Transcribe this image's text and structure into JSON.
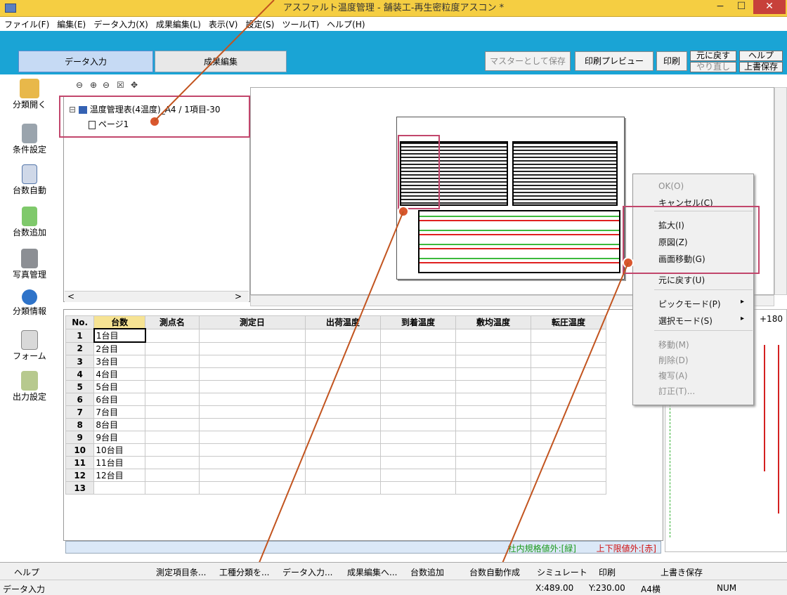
{
  "window": {
    "title": "アスファルト温度管理 - 舗装工-再生密粒度アスコン *",
    "minimize": "−",
    "maximize": "☐",
    "close": "✕"
  },
  "menu": [
    "ファイル(F)",
    "編集(E)",
    "データ入力(X)",
    "成果編集(L)",
    "表示(V)",
    "設定(S)",
    "ツール(T)",
    "ヘルプ(H)"
  ],
  "toolbar": {
    "tab_data": "データ入力",
    "tab_result": "成果編集",
    "save_master": "マスターとして保存",
    "print_preview": "印刷プレビュー",
    "print": "印刷",
    "undo": "元に戻す",
    "redo": "やり直し",
    "help": "ヘルプ",
    "overwrite": "上書保存"
  },
  "sidebar": [
    "分類開く",
    "条件設定",
    "台数自動",
    "台数追加",
    "写真管理",
    "分類情報",
    "フォーム",
    "出力設定"
  ],
  "tree": {
    "root": "温度管理表(4温度)_A4 / 1項目-30",
    "page": "ページ1"
  },
  "grid": {
    "columns": [
      "No.",
      "台数",
      "測点名",
      "測定日",
      "出荷温度",
      "到着温度",
      "敷均温度",
      "転圧温度"
    ],
    "rows": [
      [
        "1",
        "1台目"
      ],
      [
        "2",
        "2台目"
      ],
      [
        "3",
        "3台目"
      ],
      [
        "4",
        "4台目"
      ],
      [
        "5",
        "5台目"
      ],
      [
        "6",
        "6台目"
      ],
      [
        "7",
        "7台目"
      ],
      [
        "8",
        "8台目"
      ],
      [
        "9",
        "9台目"
      ],
      [
        "10",
        "10台目"
      ],
      [
        "11",
        "11台目"
      ],
      [
        "12",
        "12台目"
      ],
      [
        "13",
        ""
      ]
    ],
    "legend_green": "社内規格値外:[緑]",
    "legend_red": "上下限値外:[赤]"
  },
  "chart": {
    "label": "+180"
  },
  "context_menu": {
    "ok": "OK(O)",
    "cancel": "キャンセル(C)",
    "zoom": "拡大(I)",
    "original": "原図(Z)",
    "pan": "画面移動(G)",
    "undo": "元に戻す(U)",
    "pick": "ピックモード(P)",
    "select": "選択モード(S)",
    "move": "移動(M)",
    "delete": "削除(D)",
    "copy": "複写(A)",
    "correct": "訂正(T)..."
  },
  "taskbar": [
    "ヘルプ",
    "測定項目条...",
    "工種分類を...",
    "データ入力...",
    "成果編集へ...",
    "台数追加",
    "台数自動作成",
    "シミュレート",
    "印刷",
    "上書き保存"
  ],
  "status": {
    "mode": "データ入力",
    "x": "X:489.00",
    "y": "Y:230.00",
    "paper": "A4横",
    "num": "NUM"
  }
}
